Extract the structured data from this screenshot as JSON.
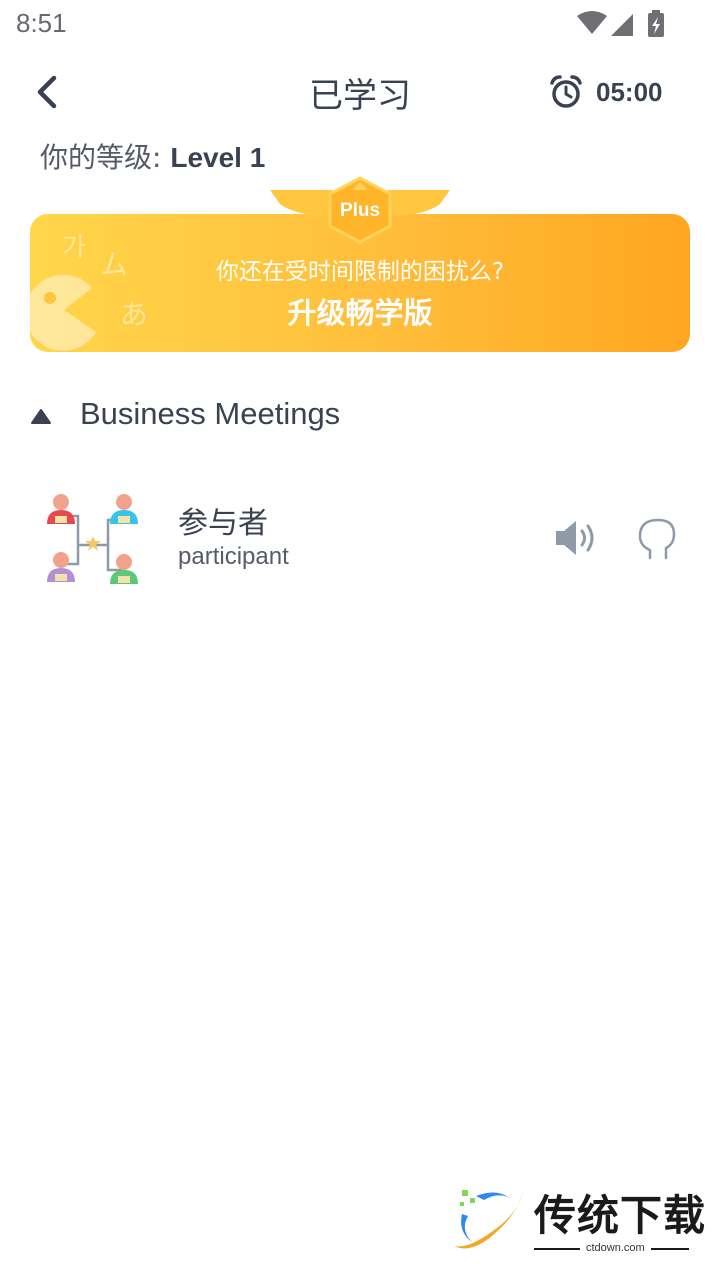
{
  "status_bar": {
    "time": "8:51"
  },
  "header": {
    "title": "已学习",
    "timer": "05:00",
    "back_icon": "chevron-left-icon",
    "timer_icon": "alarm-clock-icon"
  },
  "level": {
    "label": "你的等级:",
    "value": "Level 1"
  },
  "banner": {
    "badge": "Plus",
    "subtitle": "你还在受时间限制的困扰么?",
    "title": "升级畅学版",
    "gradient_start": "#ffd64a",
    "gradient_end": "#ffa620"
  },
  "section": {
    "title": "Business Meetings",
    "toggle_icon": "triangle-up-icon"
  },
  "words": [
    {
      "native": "参与者",
      "foreign": "participant",
      "icon": "org-chart-people-icon"
    }
  ],
  "watermark": {
    "name": "传统下载",
    "url": "ctdown.com"
  }
}
